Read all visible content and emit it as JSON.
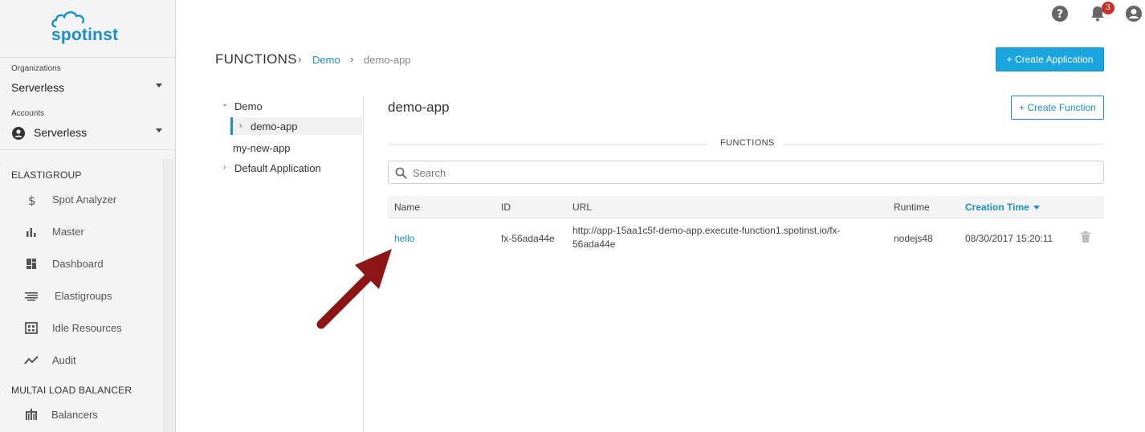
{
  "brand": {
    "logo_text": "spotinst",
    "accent": "#1a8fc9"
  },
  "sidebar": {
    "organizations": {
      "label": "Organizations",
      "value": "Serverless"
    },
    "accounts": {
      "label": "Accounts",
      "value": "Serverless"
    },
    "sections": [
      {
        "title": "ELASTIGROUP",
        "items": [
          {
            "label": "Spot Analyzer",
            "icon": "dollar-icon"
          },
          {
            "label": "Master",
            "icon": "bar-chart-icon"
          },
          {
            "label": "Dashboard",
            "icon": "dashboard-icon"
          },
          {
            "label": "Elastigroups",
            "icon": "elastigroups-icon"
          },
          {
            "label": "Idle Resources",
            "icon": "idle-resources-icon"
          },
          {
            "label": "Audit",
            "icon": "audit-icon"
          }
        ]
      },
      {
        "title": "MULTAI LOAD BALANCER",
        "items": [
          {
            "label": "Balancers",
            "icon": "balancers-icon"
          }
        ]
      }
    ]
  },
  "topbar": {
    "notification_count": "3"
  },
  "breadcrumb": {
    "root": "FUNCTIONS",
    "sep": "›",
    "link": "Demo",
    "current": "demo-app"
  },
  "actions": {
    "create_application": "+ Create Application",
    "create_function": "+ Create Function"
  },
  "tree": {
    "items": [
      {
        "label": "Demo",
        "caret": "⌄"
      },
      {
        "label": "demo-app",
        "caret": "›"
      },
      {
        "label": "my-new-app",
        "caret": ""
      },
      {
        "label": "Default Application",
        "caret": "›"
      }
    ]
  },
  "main": {
    "app_title": "demo-app",
    "functions_caption": "FUNCTIONS",
    "search_placeholder": "Search",
    "table": {
      "columns": [
        "Name",
        "ID",
        "URL",
        "Runtime",
        "Creation Time"
      ],
      "rows": [
        {
          "name": "hello",
          "id": "fx-56ada44e",
          "url": "http://app-15aa1c5f-demo-app.execute-function1.spotinst.io/fx-56ada44e",
          "runtime": "nodejs48",
          "creation_time": "08/30/2017 15:20:11"
        }
      ]
    }
  }
}
